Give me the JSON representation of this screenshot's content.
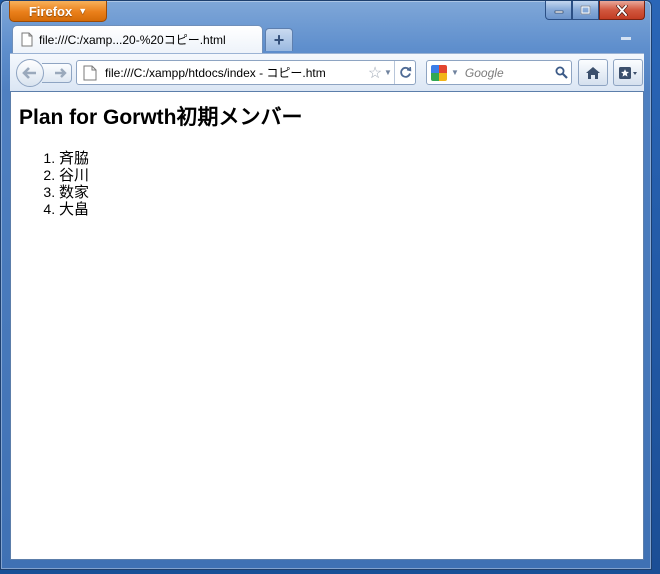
{
  "app": {
    "menu_button_label": "Firefox"
  },
  "tabs": [
    {
      "title": "file:///C:/xamp...20-%20コピー.html"
    }
  ],
  "toolbar": {
    "url": "file:///C:/xampp/htdocs/index - コピー.htm",
    "search_placeholder": "Google"
  },
  "page": {
    "heading": "Plan for Gorwth初期メンバー",
    "members": [
      "斉脇",
      "谷川",
      "数家",
      "大畠"
    ]
  },
  "icons": {
    "page": "page-icon",
    "back": "back-arrow-icon",
    "forward": "forward-arrow-icon",
    "star": "star-icon",
    "reload": "reload-icon",
    "search_engine": "google-icon",
    "search": "magnifier-icon",
    "home": "home-icon",
    "bookmarks": "bookmarks-icon"
  },
  "colors": {
    "firefox_button": "#ea7f1a",
    "window_frame": "#5f8fcd",
    "close_button": "#d1573f"
  }
}
